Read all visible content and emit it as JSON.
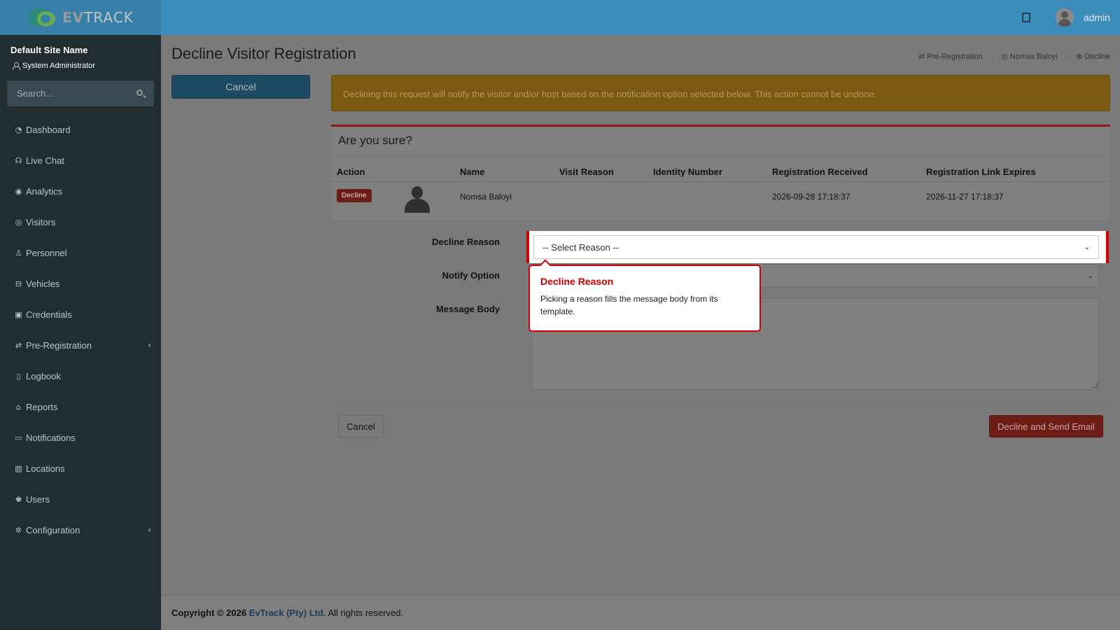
{
  "header": {
    "logo": {
      "prefix": "EV",
      "suffix": "TRACK"
    },
    "user_name": "admin"
  },
  "sidebar": {
    "site_name": "Default Site Name",
    "role": "System Administrator",
    "search_placeholder": "Search...",
    "items": [
      {
        "label": "Dashboard",
        "icon": "dashboard-icon"
      },
      {
        "label": "Live Chat",
        "icon": "headset-icon"
      },
      {
        "label": "Analytics",
        "icon": "target-icon"
      },
      {
        "label": "Visitors",
        "icon": "eye-icon"
      },
      {
        "label": "Personnel",
        "icon": "user-tie-icon"
      },
      {
        "label": "Vehicles",
        "icon": "car-icon"
      },
      {
        "label": "Credentials",
        "icon": "id-card-icon"
      },
      {
        "label": "Pre-Registration",
        "icon": "exchange-icon",
        "caret": "‹"
      },
      {
        "label": "Logbook",
        "icon": "book-icon"
      },
      {
        "label": "Reports",
        "icon": "chart-area-icon"
      },
      {
        "label": "Notifications",
        "icon": "comments-icon"
      },
      {
        "label": "Locations",
        "icon": "map-icon"
      },
      {
        "label": "Users",
        "icon": "users-cog-icon"
      },
      {
        "label": "Configuration",
        "icon": "cogs-icon",
        "caret": "‹"
      }
    ]
  },
  "page": {
    "title": "Decline Visitor Registration",
    "breadcrumb": [
      "Pre-Registration",
      "Nomsa Baloyi",
      "Decline"
    ],
    "cancel_top": "Cancel",
    "alert": "Declining this request will notify the visitor and/or host based on the notification option selected below. This action cannot be undone."
  },
  "box": {
    "title": "Are you sure?",
    "headers": [
      "Action",
      "Name",
      "Visit Reason",
      "Identity Number",
      "Registration Received",
      "Registration Link Expires"
    ],
    "row": {
      "action": "Decline",
      "name": "Nomsa Baloyi",
      "visit_reason": "",
      "identity_number": "",
      "received": "2026-09-28 17:18:37",
      "expires": "2026-11-27 17:18:37"
    }
  },
  "form": {
    "decline_reason_label": "Decline Reason",
    "decline_reason_value": "-- Select Reason --",
    "notify_label": "Notify Option",
    "notify_value": "",
    "message_label": "Message Body",
    "message_value": ""
  },
  "tooltip": {
    "title": "Decline Reason",
    "body": "Picking a reason fills the message body from its template."
  },
  "actions": {
    "cancel": "Cancel",
    "decline_send": "Decline and Send Email"
  },
  "footer": {
    "prefix": "Copyright © 2026",
    "company": "EvTrack (Pty) Ltd.",
    "suffix": "All rights reserved."
  },
  "colors": {
    "header": "#3c8dbc",
    "sidebar": "#222d32",
    "highlight": "#d00000"
  }
}
